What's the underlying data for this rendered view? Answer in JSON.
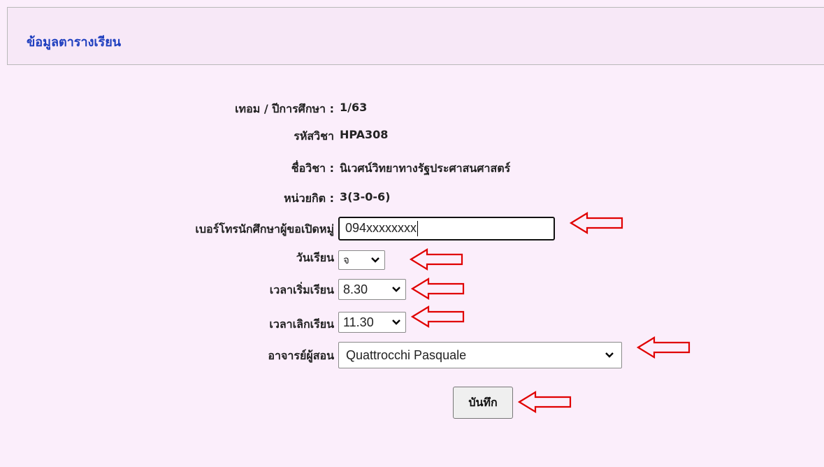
{
  "header": {
    "title": "ข้อมูลตารางเรียน"
  },
  "info": {
    "term_label": "เทอม / ปีการศึกษา :",
    "term_value": "1/63",
    "code_label": "รหัสวิชา",
    "code_value": "HPA308",
    "name_label": "ชื่อวิชา :",
    "name_value": "นิเวศน์วิทยาทางรัฐประศาสนศาสตร์",
    "credit_label": "หน่วยกิต :",
    "credit_value": "3(3-0-6)"
  },
  "form": {
    "phone_label": "เบอร์โทรนักศึกษาผู้ขอเปิดหมู่",
    "phone_value": "094xxxxxxxx",
    "day_label": "วันเรียน",
    "day_value": "จ",
    "start_label": "เวลาเริ่มเรียน",
    "start_value": "8.30",
    "end_label": "เวลาเลิกเรียน",
    "end_value": "11.30",
    "teacher_label": "อาจารย์ผู้สอน",
    "teacher_value": "Quattrocchi Pasquale",
    "save_label": "บันทึก"
  },
  "colors": {
    "accent": "#1f3fbf",
    "background": "#fbeefb",
    "annotation_arrow": "#e00000"
  },
  "icons": {
    "dropdown": "chevron-down-icon",
    "annotation": "left-arrow-icon"
  }
}
